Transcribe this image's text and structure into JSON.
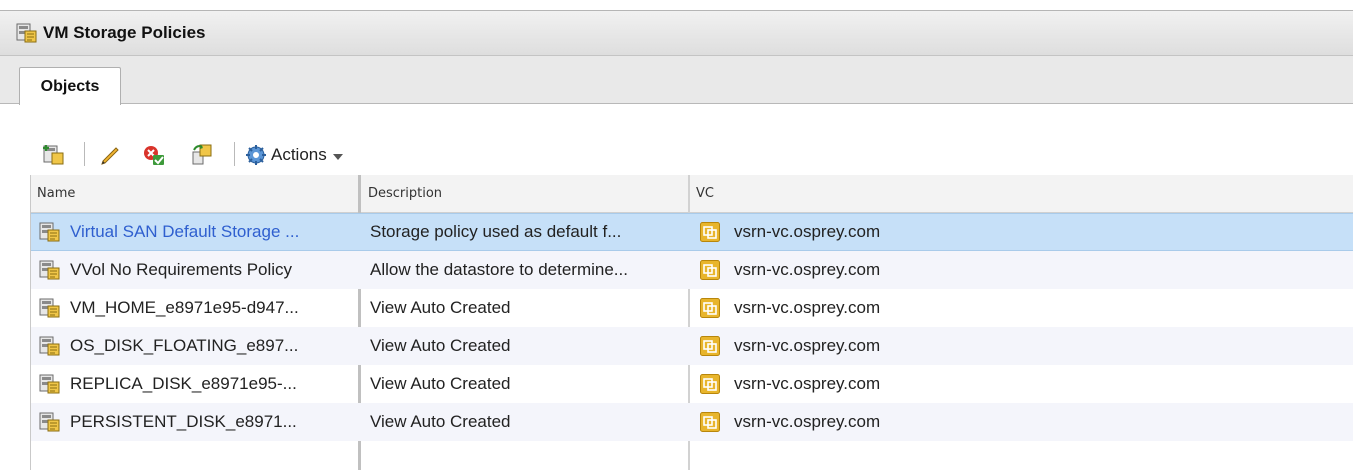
{
  "panel": {
    "title": "VM Storage Policies"
  },
  "tabs": [
    {
      "label": "Objects",
      "active": true
    }
  ],
  "toolbar": {
    "buttons": [
      {
        "icon": "create-policy-icon"
      },
      {
        "icon": "edit-pencil-icon"
      },
      {
        "icon": "check-compliance-icon"
      },
      {
        "icon": "reapply-policy-icon"
      }
    ],
    "actions_label": "Actions"
  },
  "table": {
    "columns": [
      "Name",
      "Description",
      "VC"
    ],
    "rows": [
      {
        "name": "Virtual SAN Default Storage ...",
        "description": "Storage policy used as default f...",
        "vc": "vsrn-vc.osprey.com",
        "selected": true
      },
      {
        "name": "VVol No Requirements Policy",
        "description": "Allow the datastore to determine...",
        "vc": "vsrn-vc.osprey.com"
      },
      {
        "name": "VM_HOME_e8971e95-d947...",
        "description": "View Auto Created",
        "vc": "vsrn-vc.osprey.com"
      },
      {
        "name": "OS_DISK_FLOATING_e897...",
        "description": "View Auto Created",
        "vc": "vsrn-vc.osprey.com"
      },
      {
        "name": "REPLICA_DISK_e8971e95-...",
        "description": "View Auto Created",
        "vc": "vsrn-vc.osprey.com"
      },
      {
        "name": "PERSISTENT_DISK_e8971...",
        "description": "View Auto Created",
        "vc": "vsrn-vc.osprey.com"
      }
    ]
  },
  "colors": {
    "selection": "#c6e0f8",
    "link": "#2f5fcf",
    "vc_icon": "#e8b52c"
  }
}
